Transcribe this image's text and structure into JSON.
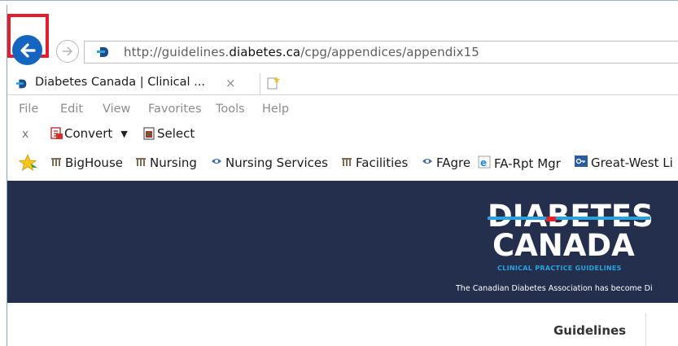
{
  "browser": {
    "address_bar": {
      "url_prefix": "http://guidelines.",
      "url_domain": "diabetes.ca",
      "url_path": "/cpg/appendices/appendix15"
    },
    "tab": {
      "title": "Diabetes Canada | Clinical ...",
      "close_glyph": "×"
    },
    "menu": [
      "File",
      "Edit",
      "View",
      "Favorites",
      "Tools",
      "Help"
    ],
    "command_bar": {
      "close_glyph": "x",
      "convert_label": "Convert",
      "convert_caret": "▼",
      "select_label": "Select"
    },
    "favorites": [
      {
        "label": "BigHouse",
        "icon": "building-icon"
      },
      {
        "label": "Nursing",
        "icon": "building-icon"
      },
      {
        "label": "Nursing Services",
        "icon": "eye-icon"
      },
      {
        "label": "Facilities",
        "icon": "building-icon"
      },
      {
        "label": "FAgre",
        "icon": "eye-icon"
      },
      {
        "label": "FA-Rpt Mgr",
        "icon": "ie-icon"
      },
      {
        "label": "Great-West Li",
        "icon": "key-icon"
      }
    ],
    "accent_color": "#1565c0",
    "highlight_color": "#e11e2b"
  },
  "page": {
    "logo": {
      "line1": "DIABETES",
      "line2": "CANADA",
      "subtitle": "CLINICAL PRACTICE GUIDELINES"
    },
    "hero_note": "The Canadian Diabetes Association has become Di",
    "nav_label": "Guidelines",
    "hero_color": "#242f4d",
    "logo_accent": "#2aa3dd"
  }
}
